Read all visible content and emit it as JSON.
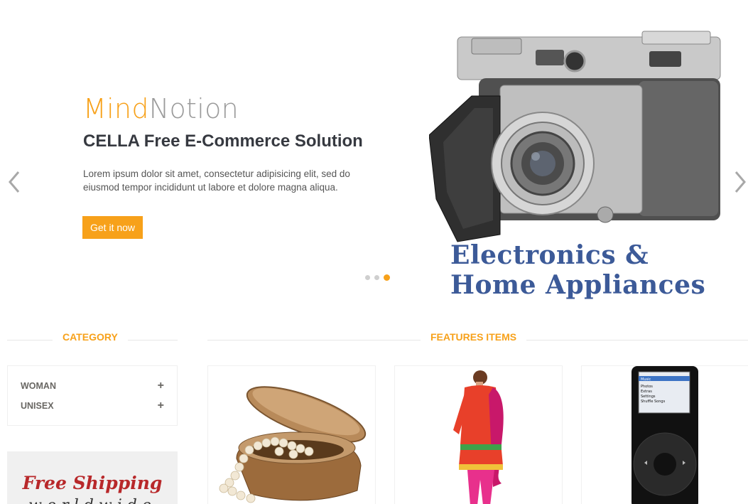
{
  "hero": {
    "brand_part1": "Mind",
    "brand_part2": "Notion",
    "headline": "CELLA Free E-Commerce Solution",
    "description": "Lorem ipsum dolor sit amet, consectetur adipisicing elit, sed do eiusmod tempor incididunt ut labore et dolore magna aliqua.",
    "cta_label": "Get it now",
    "promo_line1": "Electronics &",
    "promo_line2": "Home Appliances",
    "slide_count": 3,
    "active_slide": 3
  },
  "icons": {
    "prev": "chevron-left-icon",
    "next": "chevron-right-icon",
    "expand": "plus-icon"
  },
  "category": {
    "title": "CATEGORY",
    "items": [
      {
        "label": "WOMAN",
        "toggle": "+"
      },
      {
        "label": "UNISEX",
        "toggle": "+"
      }
    ]
  },
  "shipping": {
    "line1": "Free Shipping",
    "line2": "worldwide"
  },
  "features": {
    "title": "FEATURES ITEMS",
    "products": [
      {
        "image": "pearl-jewelry-box"
      },
      {
        "image": "woman-salwar-suit"
      },
      {
        "image": "ipod-player"
      }
    ],
    "ipod_menu": [
      "Music",
      "Photos",
      "Extras",
      "Settings",
      "Shuffle Songs"
    ]
  },
  "colors": {
    "accent": "#f7a11a",
    "promo": "#3c5a98",
    "shipping_red": "#b8282a"
  }
}
